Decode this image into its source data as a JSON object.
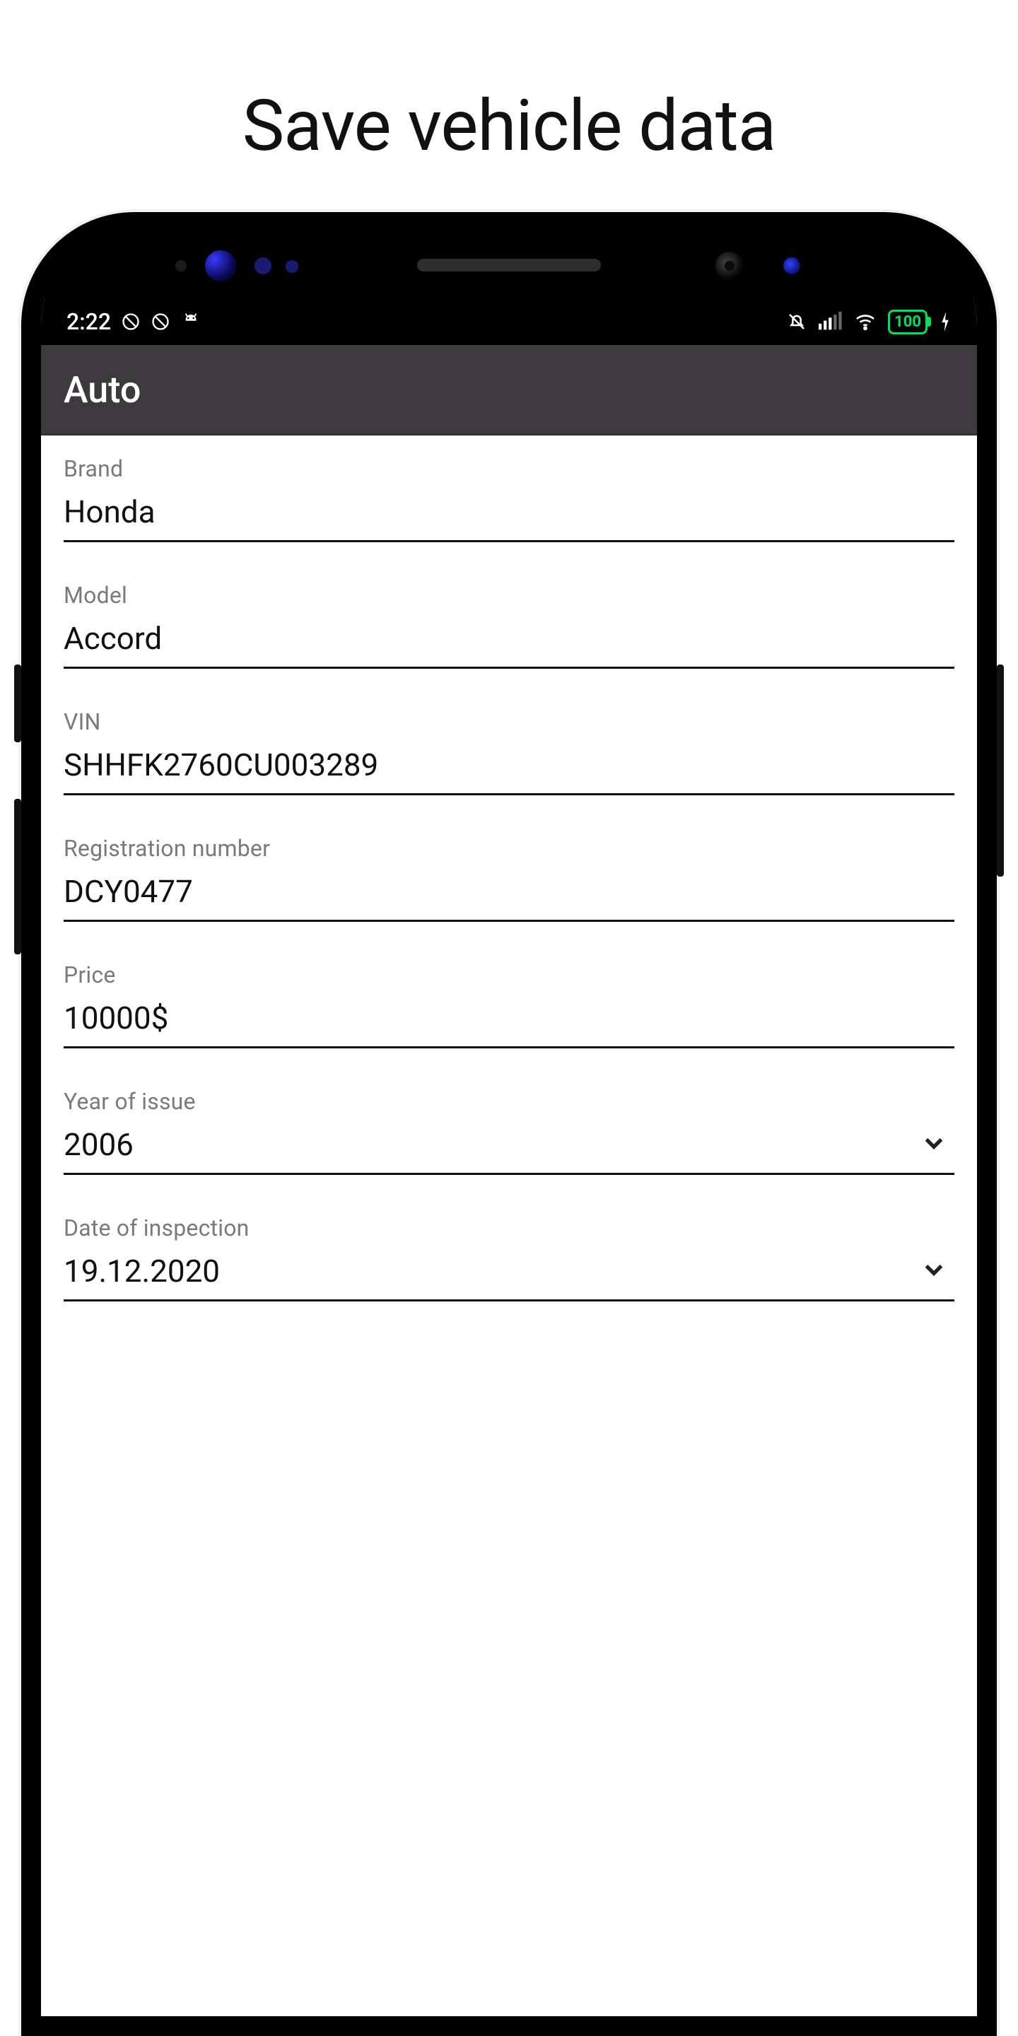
{
  "page_title": "Save vehicle data",
  "status_bar": {
    "time": "2:22",
    "battery_text": "100"
  },
  "app_bar": {
    "title": "Auto"
  },
  "fields": {
    "brand": {
      "label": "Brand",
      "value": "Honda"
    },
    "model": {
      "label": "Model",
      "value": "Accord"
    },
    "vin": {
      "label": "VIN",
      "value": "SHHFK2760CU003289"
    },
    "regnum": {
      "label": "Registration number",
      "value": "DCY0477"
    },
    "price": {
      "label": "Price",
      "value": "10000$"
    },
    "year": {
      "label": "Year of issue",
      "value": "2006"
    },
    "inspect": {
      "label": "Date of inspection",
      "value": "19.12.2020"
    }
  }
}
